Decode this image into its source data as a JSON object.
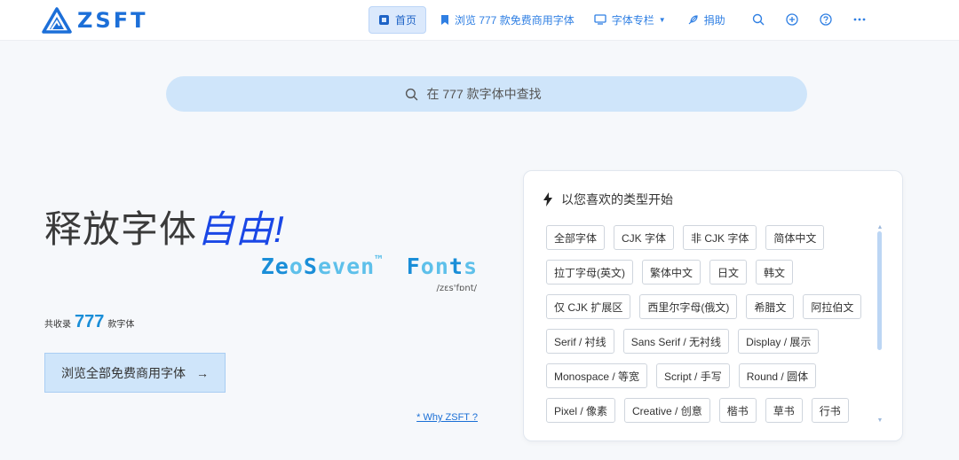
{
  "header": {
    "logo_text": "ZSFT",
    "nav": {
      "home": "首页",
      "browse": "浏览 777 款免费商用字体",
      "columns": "字体专栏",
      "donate": "捐助"
    }
  },
  "search": {
    "placeholder": "在 777 款字体中查找"
  },
  "hero": {
    "title_pre": "释放字体",
    "title_hl": "自由",
    "title_post": "!",
    "brand": {
      "ze": "Ze",
      "o": "o",
      "s": "S",
      "even": "even",
      "tm": "™",
      "f": "F",
      "on": "on",
      "t": "t",
      "s2": "s"
    },
    "phonetic": "/zɛs'fɒnt/",
    "count_prefix": "共收录",
    "count": "777",
    "count_suffix": "款字体",
    "browse_btn": "浏览全部免费商用字体",
    "browse_arrow": "→",
    "why_link": "* Why ZSFT ?"
  },
  "categories": {
    "title": "以您喜欢的类型开始",
    "rows": [
      [
        "全部字体",
        "CJK 字体",
        "非 CJK 字体",
        "简体中文"
      ],
      [
        "拉丁字母(英文)",
        "繁体中文",
        "日文",
        "韩文"
      ],
      [
        "仅 CJK 扩展区",
        "西里尔字母(俄文)",
        "希腊文",
        "阿拉伯文"
      ],
      [
        "Serif / 衬线",
        "Sans Serif / 无衬线",
        "Display / 展示"
      ],
      [
        "Monospace / 等宽",
        "Script / 手写",
        "Round / 圆体"
      ],
      [
        "Pixel / 像素",
        "Creative / 创意",
        "楷书",
        "草书",
        "行书"
      ]
    ]
  },
  "colors": {
    "accent": "#1c6fd8",
    "search_bg": "#cfe5fa",
    "title_highlight": "#1a47e6"
  }
}
